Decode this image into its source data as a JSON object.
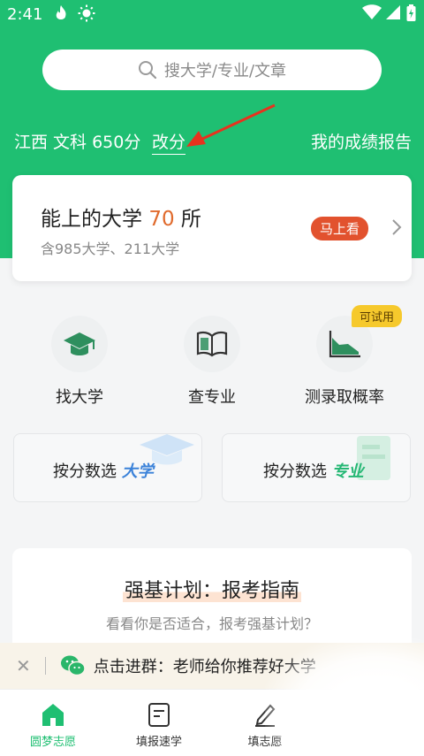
{
  "status": {
    "time": "2:41"
  },
  "search": {
    "placeholder": "搜大学/专业/文章"
  },
  "profile": {
    "score_line": "江西 文科 650分",
    "modify": "改分",
    "report": "我的成绩报告"
  },
  "card": {
    "title_prefix": "能上的大学 ",
    "count": "70",
    "title_suffix": " 所",
    "subtitle": "含985大学、211大学",
    "button": "马上看"
  },
  "tools": [
    {
      "label": "找大学",
      "icon": "graduation-cap-icon"
    },
    {
      "label": "查专业",
      "icon": "book-icon"
    },
    {
      "label": "测录取概率",
      "icon": "area-chart-icon"
    }
  ],
  "trial_badge": "可试用",
  "boxes": [
    {
      "prefix": "按分数选 ",
      "highlight": "大学",
      "color": "#3b82d9"
    },
    {
      "prefix": "按分数选 ",
      "highlight": "专业",
      "color": "#25b774"
    }
  ],
  "panel": {
    "title": "强基计划：报考指南",
    "subtitle": "看看你是否适合，报考强基计划？"
  },
  "banner": {
    "text": "点击进群：老师给你推荐好大学"
  },
  "tabs": [
    {
      "label": "圆梦志愿",
      "icon": "home-icon",
      "active": true
    },
    {
      "label": "填报速学",
      "icon": "notes-icon",
      "active": false
    },
    {
      "label": "填志愿",
      "icon": "pen-icon",
      "active": false
    }
  ],
  "colors": {
    "brand_green": "#1fbf72",
    "accent_orange": "#e06a2c",
    "pill_red": "#e2522e",
    "badge_yellow": "#f6c92c"
  }
}
